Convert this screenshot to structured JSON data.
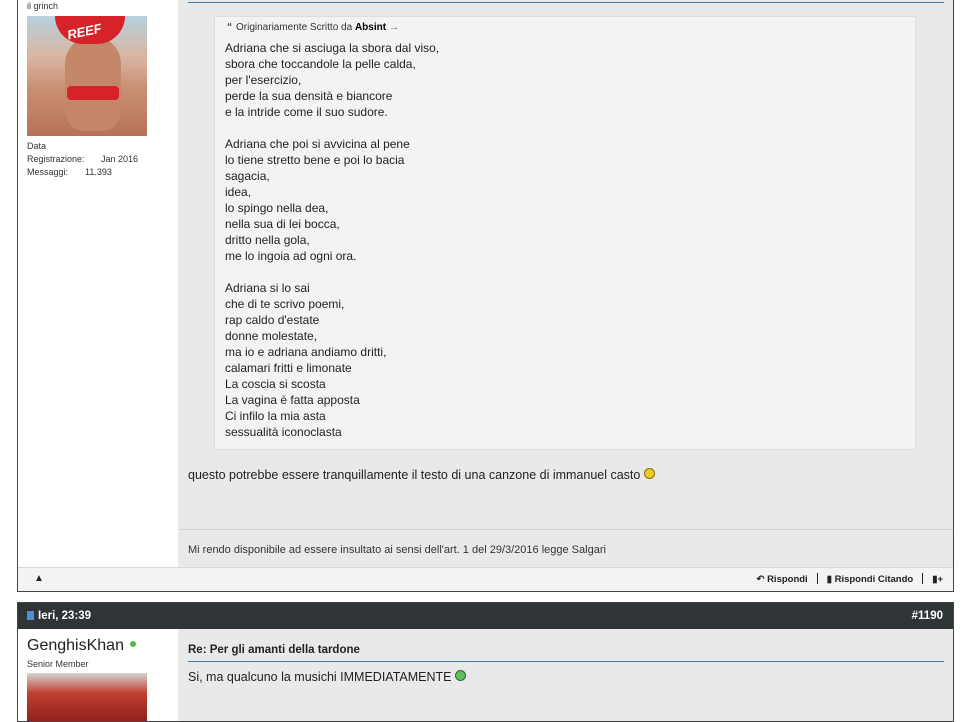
{
  "post1": {
    "user_title": "il grinch",
    "avatar_text": "REEF",
    "stats": {
      "reg_label": "Data Registrazione:",
      "reg_value": "Jan 2016",
      "msg_label": "Messaggi:",
      "msg_value": "11.393"
    },
    "quote": {
      "prefix": "Originariamente Scritto da",
      "author": "Absint",
      "lines": [
        "Adriana che si asciuga la sbora dal viso,",
        "sbora che toccandole la pelle calda,",
        "per l'esercizio,",
        "perde la sua densità e biancore",
        "e la intride come il suo sudore.",
        "",
        "Adriana che poi si avvicina al pene",
        "lo tiene stretto bene e poi lo bacia",
        "sagacia,",
        "idea,",
        "lo spingo nella dea,",
        "nella sua di lei bocca,",
        "dritto nella gola,",
        "me lo ingoia ad ogni ora.",
        "",
        "Adriana si lo sai",
        "che di te scrivo poemi,",
        "rap caldo d'estate",
        "donne molestate,",
        "ma io e adriana andiamo dritti,",
        "calamari fritti e limonate",
        "La coscia si scosta",
        "La vagina è fatta apposta",
        "Ci infilo la mia asta",
        "sessualità iconoclasta"
      ]
    },
    "message": "questo potrebbe essere tranquillamente il testo di una canzone di immanuel casto",
    "signature": "Mi rendo disponibile ad essere insultato ai sensi dell'art. 1 del 29/3/2016 legge Salgari",
    "actions": {
      "reply": "Rispondi",
      "reply_quote": "Rispondi Citando"
    }
  },
  "post2": {
    "date": "Ieri, 23:39",
    "number": "#1190",
    "username": "GenghisKhan",
    "user_title": "Senior Member",
    "title": "Re: Per gli amanti della tardone",
    "message": "Si, ma qualcuno la musichi IMMEDIATAMENTE"
  },
  "colors": {
    "accent": "#3a7ca5",
    "header_bg": "#2f3437",
    "online": "#4cbb4c"
  },
  "icons": [
    "quote-icon",
    "arrow-right-icon",
    "warning-icon",
    "reply-icon",
    "quote-reply-icon",
    "multiquote-icon",
    "document-icon",
    "smiley-icon",
    "online-status-icon"
  ]
}
